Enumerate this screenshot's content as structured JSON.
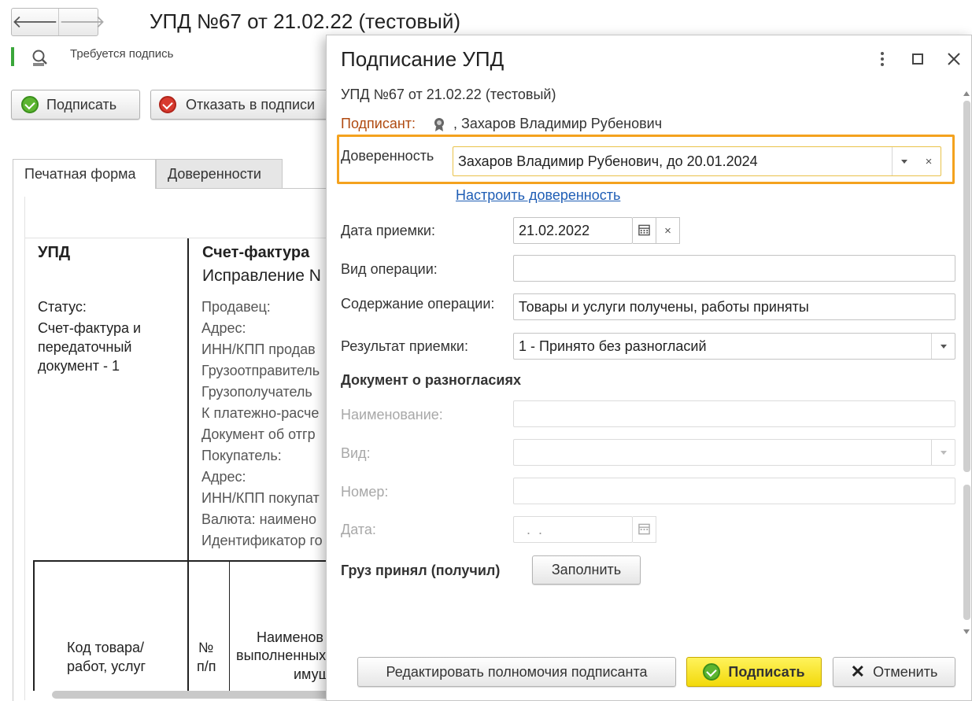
{
  "nav": {
    "back": "🡐",
    "forward": "🡒"
  },
  "document": {
    "title": "УПД №67 от 21.02.22 (тестовый)",
    "status_text": "Требуется подпись",
    "sign_button": "Подписать",
    "refuse_button": "Отказать в подписи",
    "tabs": [
      "Печатная форма",
      "Доверенности"
    ]
  },
  "print_form": {
    "upd": "УПД",
    "invoice_title": "Счет-фактура",
    "correction": "Исправление N",
    "status_label": "Статус:",
    "status_value_lines": [
      "Счет-фактура и",
      "передаточный",
      "документ - 1"
    ],
    "rows": [
      "Продавец:",
      "Адрес:",
      "ИНН/КПП продав",
      "Грузоотправитель",
      "Грузополучатель",
      "К платежно-расче",
      "Документ об отгр",
      "Покупатель:",
      "Адрес:",
      "ИНН/КПП покупат",
      "Валюта: наимено",
      "Идентификатор го"
    ],
    "col_code_lines": [
      "Код товара/",
      "работ, услуг"
    ],
    "col_num_lines": [
      "№",
      "п/п"
    ],
    "col_name_lines": [
      "Наименов",
      "выполненных",
      "имущ"
    ]
  },
  "dialog": {
    "title": "Подписание УПД",
    "doc_ref": "УПД №67 от 21.02.22 (тестовый)",
    "signer_label": "Подписант:",
    "signer_value": ", Захаров Владимир Рубенович",
    "proxy_label": "Доверенность",
    "proxy_value": "Захаров Владимир Рубенович, до 20.01.2024",
    "proxy_link": "Настроить доверенность",
    "fields": {
      "accept_date_label": "Дата приемки:",
      "accept_date_value": "21.02.2022",
      "op_type_label": "Вид операции:",
      "op_type_value": "",
      "op_content_label": "Содержание операции:",
      "op_content_value": "Товары и услуги получены, работы приняты",
      "result_label": "Результат приемки:",
      "result_value": "1 - Принято без разногласий"
    },
    "disagreement": {
      "heading": "Документ о разногласиях",
      "name_label": "Наименование:",
      "kind_label": "Вид:",
      "number_label": "Номер:",
      "date_label": "Дата:",
      "date_value": "  .  ."
    },
    "cargo_label": "Груз принял (получил)",
    "fill_button": "Заполнить",
    "footer": {
      "edit_button": "Редактировать полномочия подписанта",
      "sign_button": "Подписать",
      "cancel_button": "Отменить"
    },
    "clear_glyph": "×"
  }
}
